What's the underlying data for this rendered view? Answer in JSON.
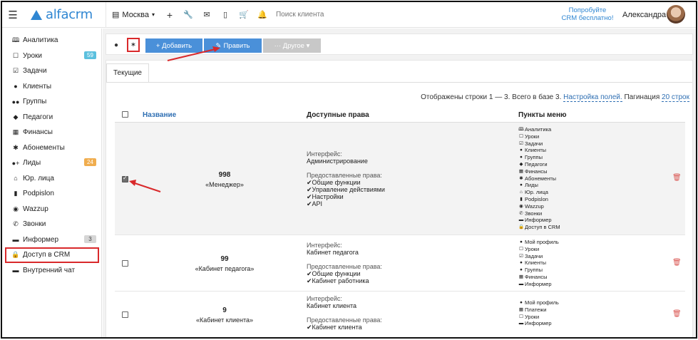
{
  "header": {
    "logo_text": "alfacrm",
    "city": "Москва",
    "search_placeholder": "Поиск клиента",
    "try_line1": "Попробуйте",
    "try_line2": "CRM бесплатно!",
    "user_name": "Александра"
  },
  "sidebar": {
    "items": [
      {
        "label": "Аналитика",
        "icon": "analytics-icon"
      },
      {
        "label": "Уроки",
        "icon": "calendar-icon",
        "badge": "59"
      },
      {
        "label": "Задачи",
        "icon": "tasks-icon"
      },
      {
        "label": "Клиенты",
        "icon": "user-icon"
      },
      {
        "label": "Группы",
        "icon": "group-icon"
      },
      {
        "label": "Педагоги",
        "icon": "graduation-cap-icon"
      },
      {
        "label": "Финансы",
        "icon": "money-icon"
      },
      {
        "label": "Абонементы",
        "icon": "subscription-icon"
      },
      {
        "label": "Лиды",
        "icon": "lead-icon",
        "badge": "24"
      },
      {
        "label": "Юр. лица",
        "icon": "bank-icon"
      },
      {
        "label": "Podpislon",
        "icon": "file-icon"
      },
      {
        "label": "Wazzup",
        "icon": "whatsapp-icon"
      },
      {
        "label": "Звонки",
        "icon": "phone-icon"
      },
      {
        "label": "Информер",
        "icon": "informer-icon",
        "badge": "3"
      },
      {
        "label": "Доступ в CRM",
        "icon": "lock-icon"
      },
      {
        "label": "Внутренний чат",
        "icon": "chat-icon"
      }
    ]
  },
  "toolbar": {
    "add_label": "+ Добавить",
    "edit_label": "Править",
    "other_label": "··· Другое ▾"
  },
  "tabs": {
    "current": "Текущие"
  },
  "table_info": {
    "text": "Отображены строки 1 — 3. Всего в базе 3.",
    "settings_link": "Настройка полей.",
    "pagination_label": "Пагинация",
    "pagination_link": "20 строк"
  },
  "columns": {
    "name": "Название",
    "rights": "Доступные права",
    "menu": "Пункты меню"
  },
  "rows": [
    {
      "num": "998",
      "desc": "«Менеджер»",
      "interface_label": "Интерфейс:",
      "interface": "Администрирование",
      "rights_label": "Предоставленные права:",
      "rights": [
        "✔Общие функции",
        "✔Управление действиями",
        "✔Настройки",
        "✔API"
      ],
      "menu": [
        "Аналитика",
        "Уроки",
        "Задачи",
        "Клиенты",
        "Группы",
        "Педагоги",
        "Финансы",
        "Абонементы",
        "Лиды",
        "Юр. лица",
        "Podpislon",
        "Wazzup",
        "Звонки",
        "Информер",
        "Доступ в CRM"
      ]
    },
    {
      "num": "99",
      "desc": "«Кабинет педагога»",
      "interface_label": "Интерфейс:",
      "interface": "Кабинет педагога",
      "rights_label": "Предоставленные права:",
      "rights": [
        "✔Общие функции",
        "✔Кабинет работника"
      ],
      "menu": [
        "Мой профиль",
        "Уроки",
        "Задачи",
        "Клиенты",
        "Группы",
        "Финансы",
        "Информер"
      ]
    },
    {
      "num": "9",
      "desc": "«Кабинет клиента»",
      "interface_label": "Интерфейс:",
      "interface": "Кабинет клиента",
      "rights_label": "Предоставленные права:",
      "rights": [
        "✔Кабинет клиента"
      ],
      "menu": [
        "Мой профиль",
        "Платежи",
        "Уроки",
        "Информер"
      ]
    }
  ],
  "colors": {
    "accent": "#2f86d2",
    "button_blue": "#4a90d9",
    "button_gray": "#c8c8c8",
    "highlight_red": "#d9292b",
    "trash_red": "#d9534f"
  }
}
